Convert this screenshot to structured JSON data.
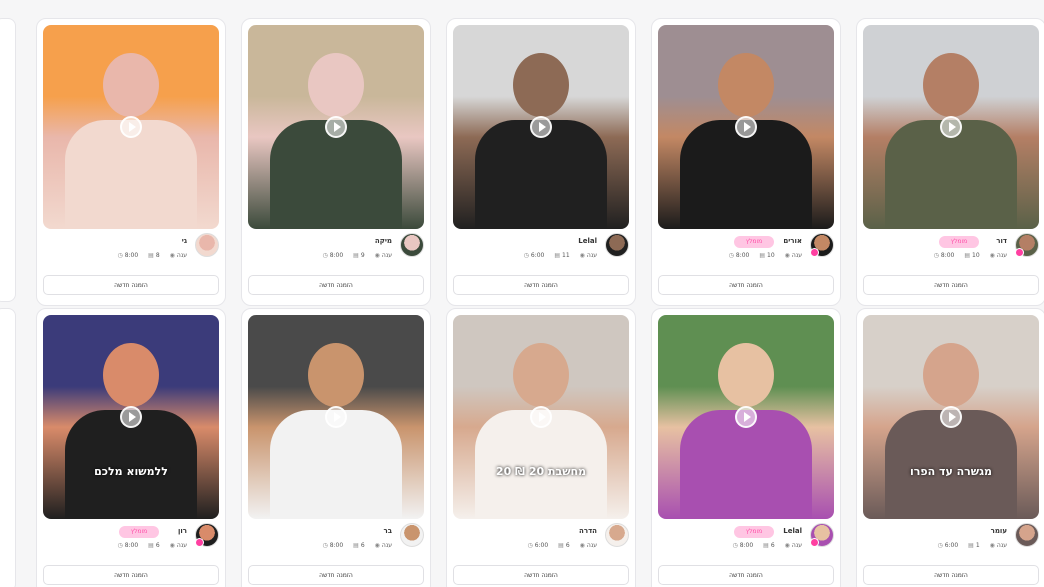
{
  "cards": [
    {
      "name": "גי",
      "stats": [
        "8:00",
        "8",
        "ענה"
      ],
      "badge": "",
      "action": "הזמנה חדשה",
      "caption": "",
      "colors": [
        "#f6a04c",
        "#f2d9cf",
        "#e9b7ab"
      ]
    },
    {
      "name": "מיקה",
      "stats": [
        "8:00",
        "9",
        "ענה"
      ],
      "badge": "",
      "action": "הזמנה חדשה",
      "caption": "",
      "colors": [
        "#c9b79a",
        "#3b4a3b",
        "#e9c7c2"
      ]
    },
    {
      "name": "Lelal",
      "stats": [
        "6:00",
        "11",
        "ענה"
      ],
      "badge": "",
      "action": "הזמנה חדשה",
      "caption": "",
      "colors": [
        "#d7d7d7",
        "#202020",
        "#8d6a55"
      ]
    },
    {
      "name": "אורים",
      "stats": [
        "8:00",
        "10",
        "ענה"
      ],
      "badge": "מומלץ",
      "action": "הזמנה חדשה",
      "caption": "",
      "colors": [
        "#9e8e92",
        "#1b1b1b",
        "#c38864"
      ]
    },
    {
      "name": "דור",
      "stats": [
        "8:00",
        "10",
        "ענה"
      ],
      "badge": "מומלץ",
      "action": "הזמנה חדשה",
      "caption": "",
      "colors": [
        "#cfd1d4",
        "#5a6148",
        "#b47f65"
      ]
    },
    {
      "name": "רון",
      "stats": [
        "8:00",
        "6",
        "ענה"
      ],
      "badge": "מומלץ",
      "action": "הזמנה חדשה",
      "caption": "ללמשוא מלכם",
      "colors": [
        "#3b3b7a",
        "#1f1f1f",
        "#d98b6a"
      ]
    },
    {
      "name": "בר",
      "stats": [
        "8:00",
        "6",
        "ענה"
      ],
      "badge": "",
      "action": "הזמנה חדשה",
      "caption": "",
      "colors": [
        "#4a4a4a",
        "#f2f2f2",
        "#c9946d"
      ]
    },
    {
      "name": "הדרה",
      "stats": [
        "6:00",
        "6",
        "ענה"
      ],
      "badge": "",
      "action": "הזמנה חדשה",
      "caption": "20 ₪ מחשבת 20",
      "colors": [
        "#cfc7c0",
        "#f5f0ec",
        "#d7a98e"
      ]
    },
    {
      "name": "Lelal",
      "stats": [
        "8:00",
        "6",
        "ענה"
      ],
      "badge": "מומלץ",
      "action": "הזמנה חדשה",
      "caption": "",
      "colors": [
        "#5f8f52",
        "#a84fb0",
        "#e7c1a2"
      ]
    },
    {
      "name": "עומר",
      "stats": [
        "6:00",
        "1",
        "ענה"
      ],
      "badge": "",
      "action": "הזמנה חדשה",
      "caption": "מגשרה עד הפרו",
      "colors": [
        "#d7d0c9",
        "#6a5a58",
        "#d5a48c"
      ]
    }
  ]
}
